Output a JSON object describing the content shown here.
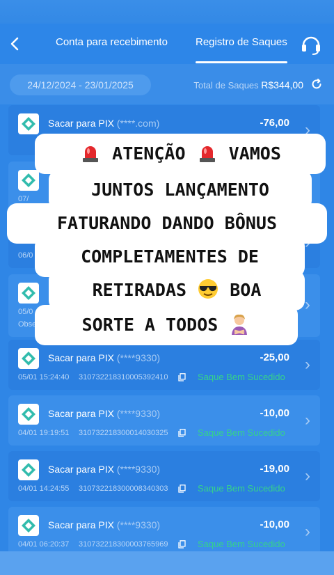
{
  "nav": {
    "tab_account": "Conta para recebimento",
    "tab_history": "Registro de Saques"
  },
  "filter": {
    "date_range": "24/12/2024 - 23/01/2025",
    "total_label": "Total de Saques",
    "total_value": "R$344,00"
  },
  "cards": [
    {
      "title": "Sacar para PIX",
      "account": "(****.com)",
      "amount": "-76,00",
      "date": "",
      "txid": "",
      "status": ""
    },
    {
      "title": "",
      "account": "",
      "amount": "",
      "date": "07/",
      "txid": "",
      "status": ""
    },
    {
      "title": "",
      "account": "",
      "amount": "",
      "date": "06/0",
      "txid": "",
      "status": ""
    },
    {
      "title": "",
      "account": "",
      "amount": "",
      "date": "05/0",
      "txid": "Obse",
      "status": ""
    },
    {
      "title": "Sacar para PIX",
      "account": "(****9330)",
      "amount": "-25,00",
      "date": "05/01 15:24:40",
      "txid": "310732218310005392410",
      "status": "Saque Bem Sucedido"
    },
    {
      "title": "Sacar para PIX",
      "account": "(****9330)",
      "amount": "-10,00",
      "date": "04/01 19:19:51",
      "txid": "310732218300014030325",
      "status": "Saque Bem Sucedido"
    },
    {
      "title": "Sacar para PIX",
      "account": "(****9330)",
      "amount": "-19,00",
      "date": "04/01 14:24:55",
      "txid": "310732218300008340303",
      "status": "Saque Bem Sucedido"
    },
    {
      "title": "Sacar para PIX",
      "account": "(****9330)",
      "amount": "-10,00",
      "date": "04/01 06:20:37",
      "txid": "310732218300003765969",
      "status": "Saque Bem Sucedido"
    }
  ],
  "overlay": {
    "line1_a": "ATENÇÃO",
    "line1_b": "VAMOS",
    "line2": "JUNTOS LANÇAMENTO",
    "line3": "FATURANDO DANDO BÔNUS",
    "line4": "COMPLETAMENTES DE",
    "line5_a": "RETIRADAS",
    "line5_b": "BOA",
    "line6": "SORTE A TODOS"
  },
  "colors": {
    "background": "#2f86e6",
    "card": "#2b7fe0",
    "success": "#35d38a",
    "pix_icon": "#32bcad"
  }
}
